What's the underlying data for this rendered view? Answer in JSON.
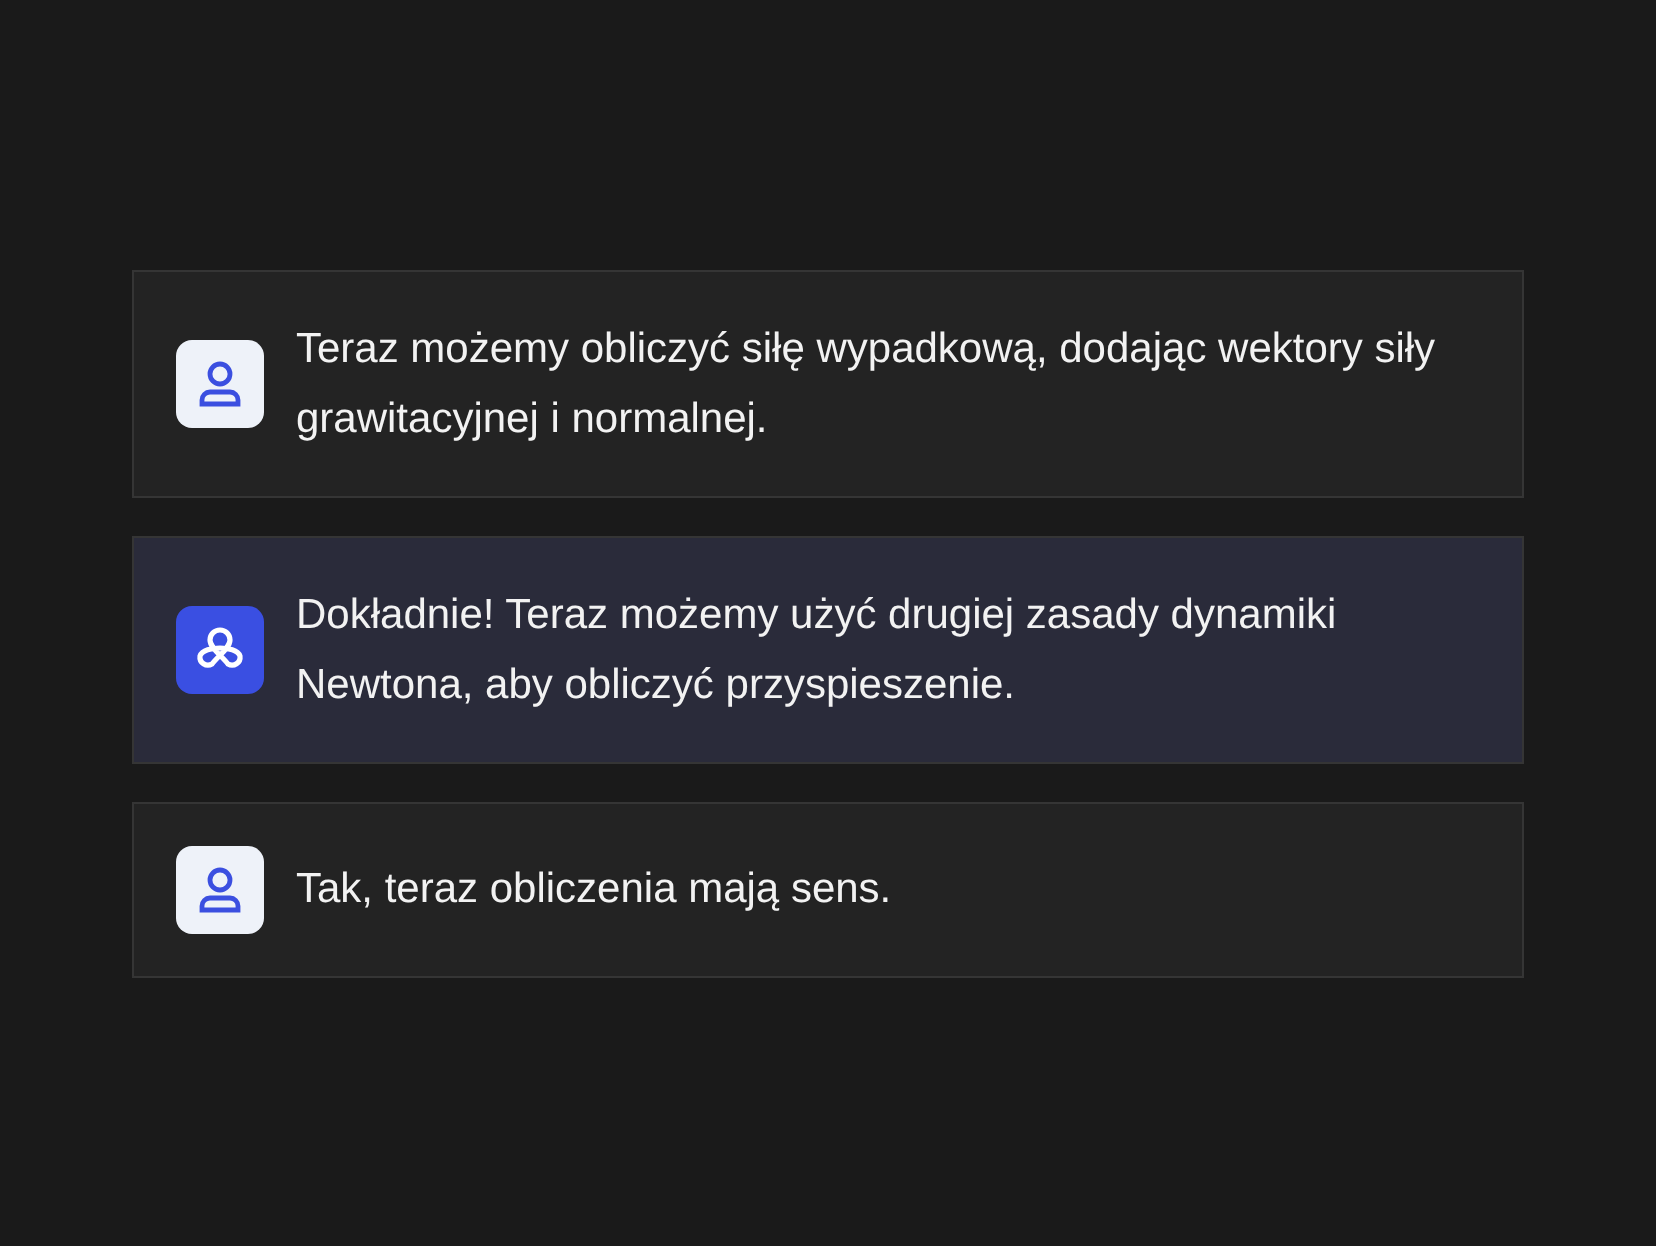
{
  "messages": [
    {
      "kind": "user",
      "text": "Teraz możemy obliczyć siłę wypadkową, dodając wektory siły grawitacyjnej i normalnej."
    },
    {
      "kind": "assistant",
      "text": "Dokładnie! Teraz możemy użyć drugiej zasady dynamiki Newtona, aby obliczyć przyspieszenie."
    },
    {
      "kind": "user",
      "text": "Tak, teraz obliczenia mają sens."
    }
  ]
}
